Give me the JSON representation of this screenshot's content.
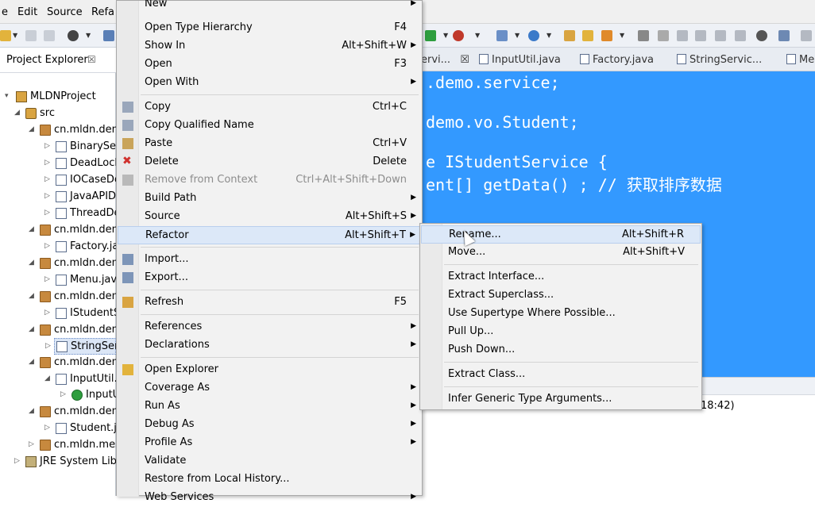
{
  "menubar": {
    "items": [
      "e",
      "Edit",
      "Source",
      "Refa"
    ]
  },
  "explorer": {
    "title": "Project Explorer",
    "close": "☒",
    "tree": [
      {
        "label": "MLDNProject",
        "icon": "project-icon",
        "twisty": "▾",
        "depth": 0
      },
      {
        "label": "src",
        "icon": "source-folder-icon",
        "twisty": "◢",
        "depth": 1
      },
      {
        "label": "cn.mldn.dem",
        "icon": "package-icon",
        "twisty": "◢",
        "depth": 2
      },
      {
        "label": "BinarySea",
        "icon": "java-file-icon",
        "twisty": "▷",
        "depth": 3
      },
      {
        "label": "DeadLock",
        "icon": "java-file-icon",
        "twisty": "▷",
        "depth": 3
      },
      {
        "label": "IOCaseDe",
        "icon": "java-file-icon",
        "twisty": "▷",
        "depth": 3
      },
      {
        "label": "JavaAPID",
        "icon": "java-file-icon",
        "twisty": "▷",
        "depth": 3
      },
      {
        "label": "ThreadDe",
        "icon": "java-file-icon",
        "twisty": "▷",
        "depth": 3
      },
      {
        "label": "cn.mldn.dem",
        "icon": "package-icon",
        "twisty": "◢",
        "depth": 2
      },
      {
        "label": "Factory.ja",
        "icon": "java-file-icon",
        "twisty": "▷",
        "depth": 3
      },
      {
        "label": "cn.mldn.dem",
        "icon": "package-icon",
        "twisty": "◢",
        "depth": 2
      },
      {
        "label": "Menu.java",
        "icon": "java-file-icon",
        "twisty": "▷",
        "depth": 3
      },
      {
        "label": "cn.mldn.dem",
        "icon": "package-icon",
        "twisty": "◢",
        "depth": 2
      },
      {
        "label": "IStudentS",
        "icon": "java-interface-icon",
        "twisty": "▷",
        "depth": 3
      },
      {
        "label": "cn.mldn.dem",
        "icon": "package-icon",
        "twisty": "◢",
        "depth": 2
      },
      {
        "label": "StringSer",
        "icon": "java-file-icon",
        "twisty": "▷",
        "depth": 3,
        "selected": true
      },
      {
        "label": "cn.mldn.dem",
        "icon": "package-icon",
        "twisty": "◢",
        "depth": 2
      },
      {
        "label": "InputUtil.j",
        "icon": "java-file-icon",
        "twisty": "◢",
        "depth": 3
      },
      {
        "label": "InputU",
        "icon": "class-icon",
        "twisty": "▷",
        "depth": 4
      },
      {
        "label": "cn.mldn.dem",
        "icon": "package-icon",
        "twisty": "◢",
        "depth": 2
      },
      {
        "label": "Student.ja",
        "icon": "java-file-icon",
        "twisty": "▷",
        "depth": 3
      },
      {
        "label": "cn.mldn.mes",
        "icon": "package-icon",
        "twisty": "▷",
        "depth": 2
      },
      {
        "label": "JRE System Libr",
        "icon": "library-icon",
        "twisty": "▷",
        "depth": 1
      }
    ]
  },
  "editor": {
    "tabs": [
      "ervi...",
      "InputUtil.java",
      "Factory.java",
      "StringServic...",
      "Me"
    ],
    "tab_close": "☒",
    "code_lines": [
      ".demo.service;",
      "demo.vo.Student;",
      "e IStudentService {",
      "ent[] getData() ; // 获取排序数据"
    ],
    "lower_text": "18:42)"
  },
  "context_menu": {
    "items": [
      {
        "label": "New",
        "accel": "",
        "submenu": true
      },
      {
        "label": "Open Type Hierarchy",
        "accel": "F4"
      },
      {
        "label": "Show In",
        "accel": "Alt+Shift+W",
        "submenu": true
      },
      {
        "label": "Open",
        "accel": "F3"
      },
      {
        "label": "Open With",
        "accel": "",
        "submenu": true
      },
      {
        "label": "Copy",
        "accel": "Ctrl+C",
        "icon": "copy-icon"
      },
      {
        "label": "Copy Qualified Name",
        "accel": "",
        "icon": "copy-qualified-icon"
      },
      {
        "label": "Paste",
        "accel": "Ctrl+V",
        "icon": "paste-icon"
      },
      {
        "label": "Delete",
        "accel": "Delete",
        "icon": "delete-icon"
      },
      {
        "label": "Remove from Context",
        "accel": "Ctrl+Alt+Shift+Down",
        "icon": "remove-context-icon",
        "disabled": true
      },
      {
        "label": "Build Path",
        "accel": "",
        "submenu": true
      },
      {
        "label": "Source",
        "accel": "Alt+Shift+S",
        "submenu": true
      },
      {
        "label": "Refactor",
        "accel": "Alt+Shift+T",
        "submenu": true,
        "highlighted": true
      },
      {
        "label": "Import...",
        "accel": "",
        "icon": "import-icon"
      },
      {
        "label": "Export...",
        "accel": "",
        "icon": "export-icon"
      },
      {
        "label": "Refresh",
        "accel": "F5",
        "icon": "refresh-icon"
      },
      {
        "label": "References",
        "accel": "",
        "submenu": true
      },
      {
        "label": "Declarations",
        "accel": "",
        "submenu": true
      },
      {
        "label": "Open Explorer",
        "accel": "",
        "icon": "open-explorer-icon"
      },
      {
        "label": "Coverage As",
        "accel": "",
        "submenu": true
      },
      {
        "label": "Run As",
        "accel": "",
        "submenu": true
      },
      {
        "label": "Debug As",
        "accel": "",
        "submenu": true
      },
      {
        "label": "Profile As",
        "accel": "",
        "submenu": true
      },
      {
        "label": "Validate",
        "accel": ""
      },
      {
        "label": "Restore from Local History...",
        "accel": ""
      },
      {
        "label": "Web Services",
        "accel": "",
        "submenu": true
      }
    ]
  },
  "refactor_submenu": {
    "items": [
      {
        "label": "Rename...",
        "accel": "Alt+Shift+R",
        "highlighted": true
      },
      {
        "label": "Move...",
        "accel": "Alt+Shift+V"
      },
      {
        "label": "Extract Interface...",
        "accel": ""
      },
      {
        "label": "Extract Superclass...",
        "accel": ""
      },
      {
        "label": "Use Supertype Where Possible...",
        "accel": ""
      },
      {
        "label": "Pull Up...",
        "accel": ""
      },
      {
        "label": "Push Down...",
        "accel": ""
      },
      {
        "label": "Extract Class...",
        "accel": ""
      },
      {
        "label": "Infer Generic Type Arguments...",
        "accel": ""
      }
    ]
  },
  "colors": {
    "editor_bg": "#3399ff",
    "menu_bg": "#f2f2f2",
    "highlight": "#dce8f8"
  }
}
